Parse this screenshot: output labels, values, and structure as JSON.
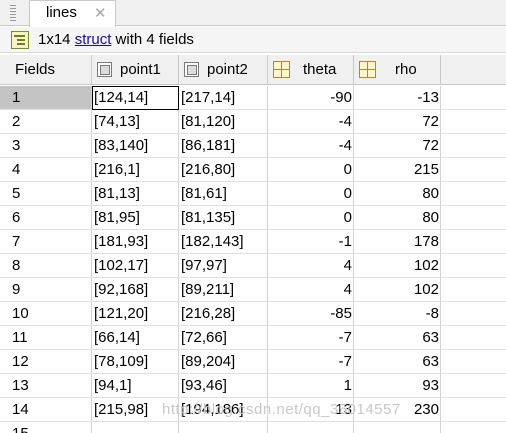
{
  "tab": {
    "title": "lines",
    "close_glyph": "✕"
  },
  "info": {
    "prefix": "1x14 ",
    "link": "struct",
    "suffix": " with 4 fields"
  },
  "table": {
    "fields_header": "Fields",
    "columns": [
      {
        "name": "point1",
        "icon": "cell-array-icon"
      },
      {
        "name": "point2",
        "icon": "cell-array-icon"
      },
      {
        "name": "theta",
        "icon": "numeric-matrix-icon"
      },
      {
        "name": "rho",
        "icon": "numeric-matrix-icon"
      }
    ],
    "rows": [
      {
        "index": "1",
        "point1": "[124,14]",
        "point2": "[217,14]",
        "theta": "-90",
        "rho": "-13"
      },
      {
        "index": "2",
        "point1": "[74,13]",
        "point2": "[81,120]",
        "theta": "-4",
        "rho": "72"
      },
      {
        "index": "3",
        "point1": "[83,140]",
        "point2": "[86,181]",
        "theta": "-4",
        "rho": "72"
      },
      {
        "index": "4",
        "point1": "[216,1]",
        "point2": "[216,80]",
        "theta": "0",
        "rho": "215"
      },
      {
        "index": "5",
        "point1": "[81,13]",
        "point2": "[81,61]",
        "theta": "0",
        "rho": "80"
      },
      {
        "index": "6",
        "point1": "[81,95]",
        "point2": "[81,135]",
        "theta": "0",
        "rho": "80"
      },
      {
        "index": "7",
        "point1": "[181,93]",
        "point2": "[182,143]",
        "theta": "-1",
        "rho": "178"
      },
      {
        "index": "8",
        "point1": "[102,17]",
        "point2": "[97,97]",
        "theta": "4",
        "rho": "102"
      },
      {
        "index": "9",
        "point1": "[92,168]",
        "point2": "[89,211]",
        "theta": "4",
        "rho": "102"
      },
      {
        "index": "10",
        "point1": "[121,20]",
        "point2": "[216,28]",
        "theta": "-85",
        "rho": "-8"
      },
      {
        "index": "11",
        "point1": "[66,14]",
        "point2": "[72,66]",
        "theta": "-7",
        "rho": "63"
      },
      {
        "index": "12",
        "point1": "[78,109]",
        "point2": "[89,204]",
        "theta": "-7",
        "rho": "63"
      },
      {
        "index": "13",
        "point1": "[94,1]",
        "point2": "[93,46]",
        "theta": "1",
        "rho": "93"
      },
      {
        "index": "14",
        "point1": "[215,98]",
        "point2": "[194,186]",
        "theta": "13",
        "rho": "230"
      },
      {
        "index": "15",
        "point1": "",
        "point2": "",
        "theta": "",
        "rho": ""
      }
    ]
  },
  "watermark": "http://blog.csdn.net/qq_35014557"
}
